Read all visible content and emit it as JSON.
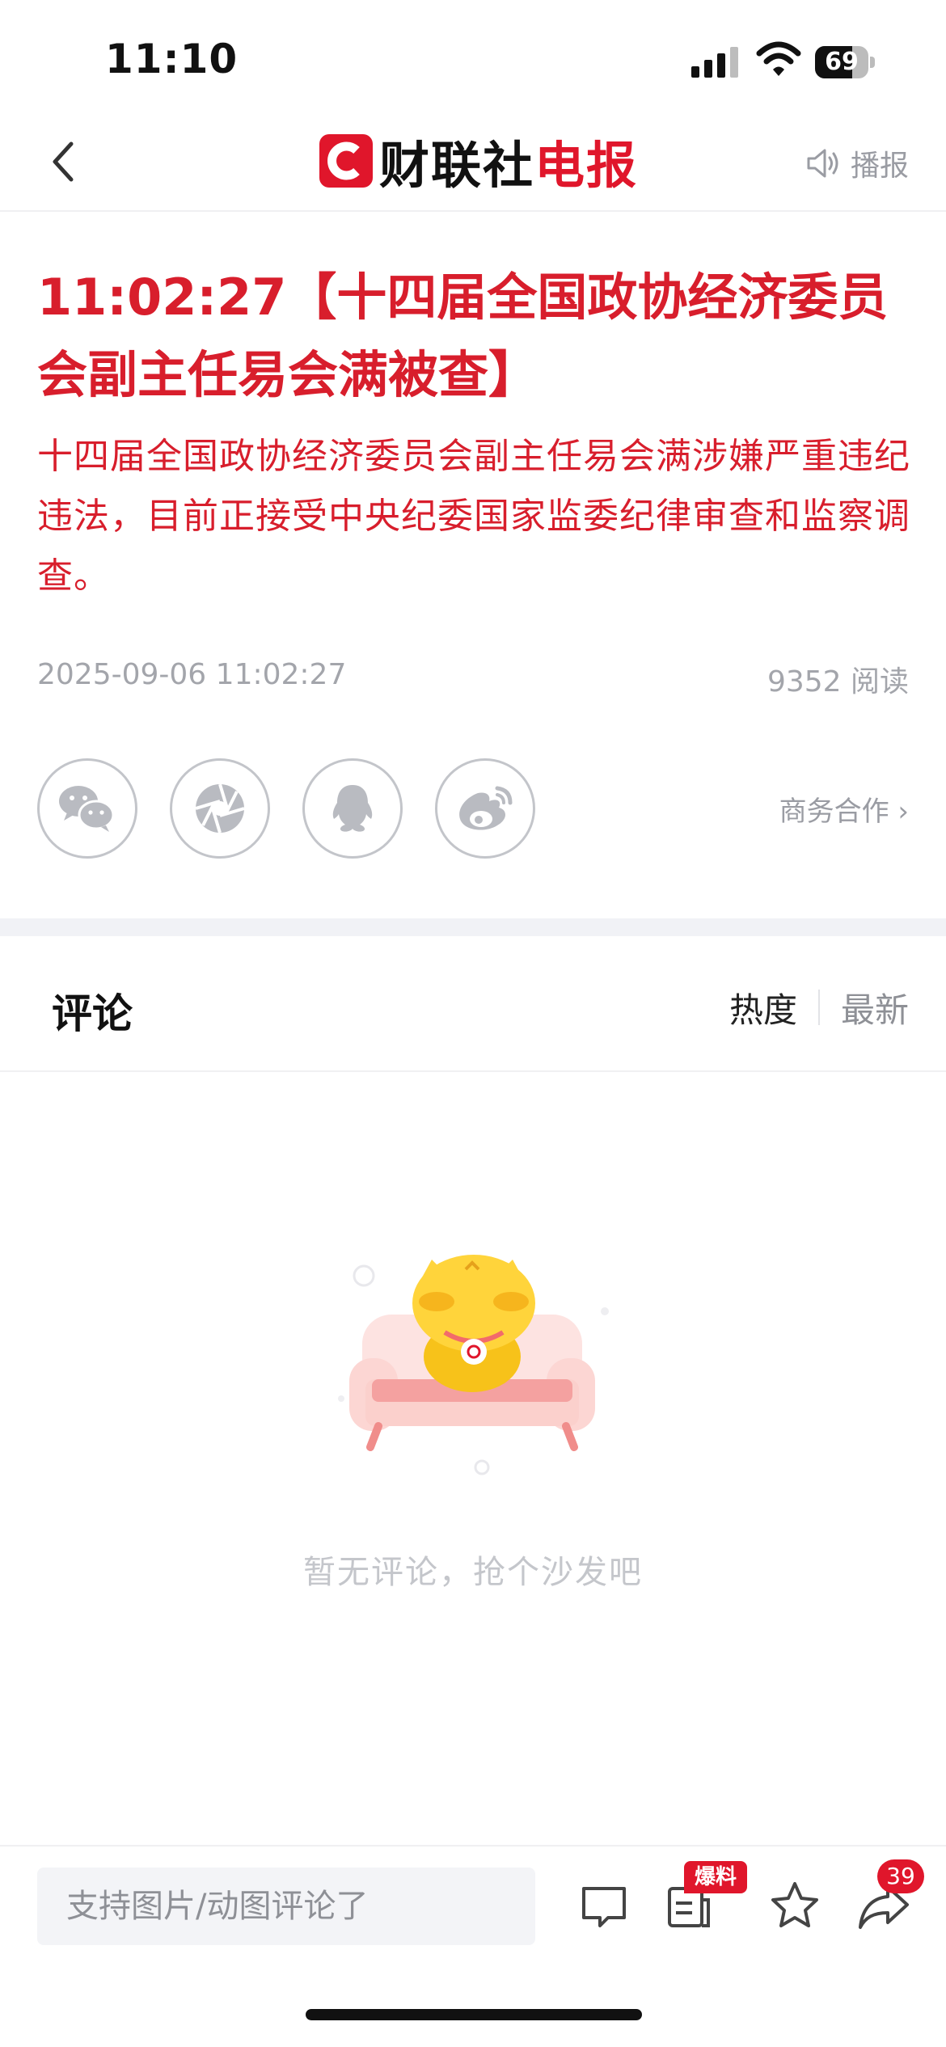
{
  "status_bar": {
    "time": "11:10",
    "battery_level": "69"
  },
  "nav": {
    "brand_black": "财联社",
    "brand_red": "电报",
    "broadcast_label": "播报"
  },
  "article": {
    "title": "11:02:27【十四届全国政协经济委员会副主任易会满被查】",
    "body": "十四届全国政协经济委员会副主任易会满涉嫌严重违纪违法，目前正接受中央纪委国家监委纪律审查和监察调查。",
    "date": "2025-09-06 11:02:27",
    "reads": "9352 阅读"
  },
  "share": {
    "items": [
      "wechat-icon",
      "moments-icon",
      "qq-icon",
      "weibo-icon"
    ],
    "business_label": "商务合作 ›"
  },
  "comments": {
    "title": "评论",
    "sort_hot": "热度",
    "sort_new": "最新",
    "empty_text": "暂无评论，抢个沙发吧"
  },
  "bottom_bar": {
    "input_placeholder": "支持图片/动图评论了",
    "tip_badge": "爆料",
    "share_count": "39"
  },
  "colors": {
    "accent": "#e0162b",
    "headline": "#d81e2c",
    "muted": "#a3a5ab"
  }
}
